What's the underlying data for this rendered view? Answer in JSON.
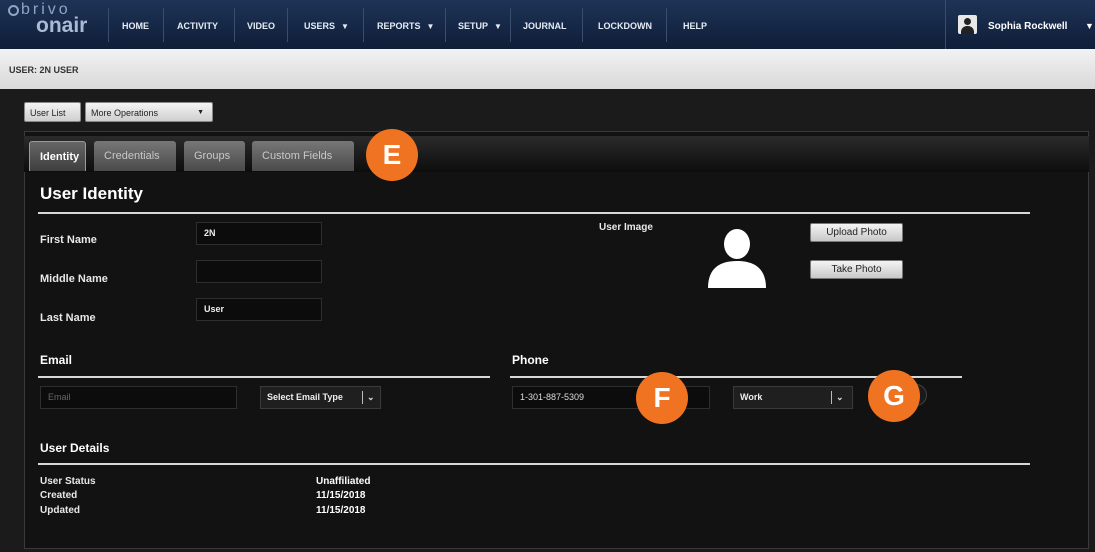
{
  "app": {
    "logo_top": "brivo",
    "logo_bottom": "onair"
  },
  "nav": {
    "items": [
      "HOME",
      "ACTIVITY",
      "VIDEO",
      "USERS",
      "REPORTS",
      "SETUP",
      "JOURNAL",
      "LOCKDOWN",
      "HELP"
    ],
    "dropdown_marker": "▼",
    "user_name": "Sophia Rockwell"
  },
  "breadcrumb": "USER: 2N USER",
  "toolbar": {
    "user_list": "User List",
    "more_operations": "More Operations"
  },
  "tabs": [
    "Identity",
    "Credentials",
    "Groups",
    "Custom Fields"
  ],
  "identity": {
    "section_title": "User Identity",
    "first_name_label": "First Name",
    "first_name_value": "2N",
    "middle_name_label": "Middle Name",
    "middle_name_value": "",
    "last_name_label": "Last Name",
    "last_name_value": "User",
    "user_image_label": "User Image",
    "upload_photo": "Upload Photo",
    "take_photo": "Take Photo"
  },
  "email": {
    "section_title": "Email",
    "placeholder": "Email",
    "type_select": "Select Email Type"
  },
  "phone": {
    "section_title": "Phone",
    "value": "1-301-887-5309",
    "type_select": "Work"
  },
  "details": {
    "section_title": "User Details",
    "rows": [
      {
        "label": "User Status",
        "value": "Unaffiliated"
      },
      {
        "label": "Created",
        "value": "11/15/2018"
      },
      {
        "label": "Updated",
        "value": "11/15/2018"
      }
    ]
  },
  "callouts": {
    "e": "E",
    "f": "F",
    "g": "G",
    "color": "#f07322"
  },
  "icons": {
    "user_image": "user-silhouette-icon",
    "avatar": "user-avatar-icon"
  }
}
